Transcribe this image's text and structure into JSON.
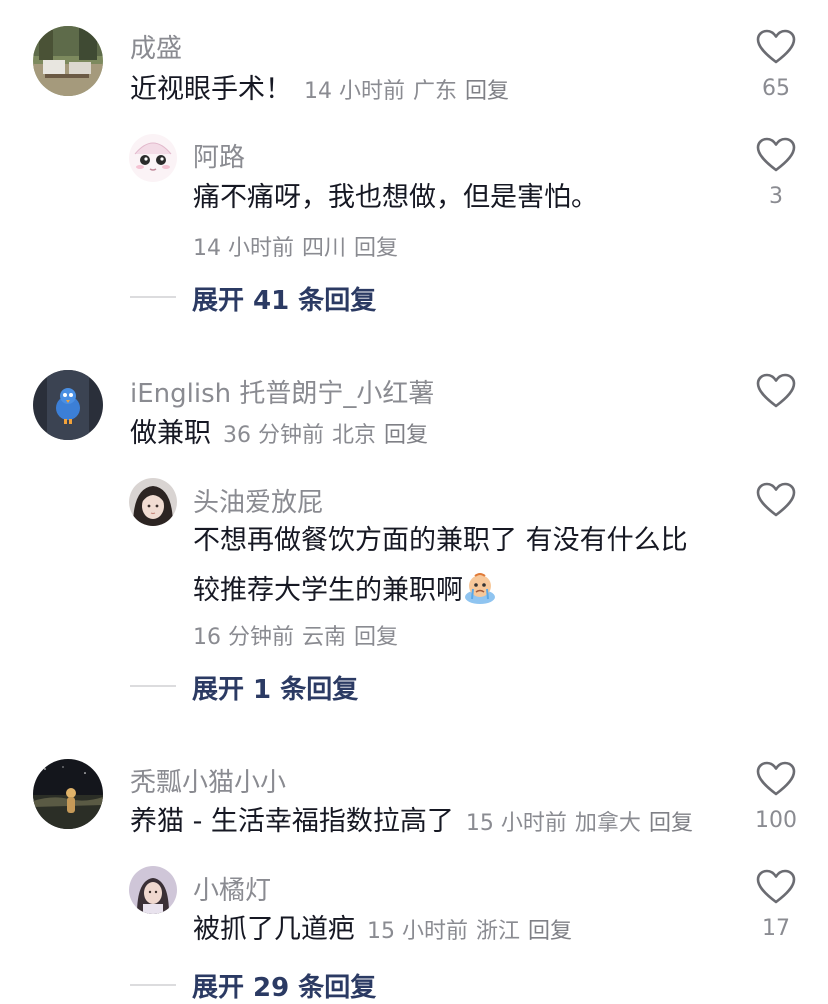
{
  "threads": [
    {
      "comment": {
        "user": "成盛",
        "text": "近视眼手术！",
        "time": "14 小时前",
        "location": "广东",
        "reply": "回复",
        "likes": "65",
        "avatar_icon": "landscape-avatar"
      },
      "reply": {
        "user": "阿路",
        "text": "痛不痛呀，我也想做，但是害怕。",
        "time": "14 小时前",
        "location": "四川",
        "reply": "回复",
        "likes": "3",
        "avatar_icon": "cartoon-face-avatar"
      },
      "expand": "展开 41 条回复"
    },
    {
      "comment": {
        "user": "iEnglish 托普朗宁_小红薯",
        "text": "做兼职",
        "time": "36 分钟前",
        "location": "北京",
        "reply": "回复",
        "likes": "",
        "avatar_icon": "blue-bird-avatar"
      },
      "reply": {
        "user": "头油爱放屁",
        "text_line1": "不想再做餐饮方面的兼职了 有没有什么比",
        "text_line2": "较推荐大学生的兼职啊",
        "time": "16 分钟前",
        "location": "云南",
        "reply": "回复",
        "likes": "",
        "avatar_icon": "girl-photo-avatar",
        "emoji_icon": "crying-face-emoji"
      },
      "expand": "展开 1 条回复"
    },
    {
      "comment": {
        "user": "秃瓢小猫小小",
        "text": "养猫 - 生活幸福指数拉高了",
        "time": "15 小时前",
        "location": "加拿大",
        "reply": "回复",
        "likes": "100",
        "avatar_icon": "night-sky-avatar"
      },
      "reply": {
        "user": "小橘灯",
        "text": "被抓了几道疤",
        "time": "15 小时前",
        "location": "浙江",
        "reply": "回复",
        "likes": "17",
        "avatar_icon": "girl-portrait-avatar"
      },
      "expand": "展开 29 条回复"
    }
  ],
  "colors": {
    "secondary_text": "#8a8b91",
    "primary_text": "#161823",
    "expand_text": "#2b3a63"
  }
}
